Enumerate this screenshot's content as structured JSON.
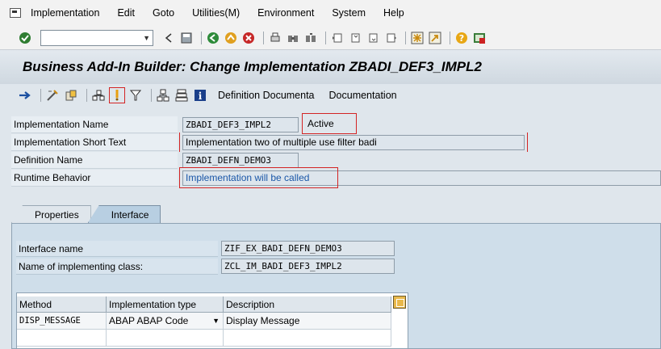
{
  "menu": {
    "items": [
      "Implementation",
      "Edit",
      "Goto",
      "Utilities(M)",
      "Environment",
      "System",
      "Help"
    ]
  },
  "title": "Business Add-In Builder: Change Implementation ZBADI_DEF3_IMPL2",
  "app_toolbar": {
    "definition_doc": "Definition Documenta",
    "documentation": "Documentation"
  },
  "form": {
    "impl_name_label": "Implementation Name",
    "impl_name_value": "ZBADI_DEF3_IMPL2",
    "status": "Active",
    "short_text_label": "Implementation Short Text",
    "short_text_value": "Implementation two of multiple use filter badi",
    "def_name_label": "Definition Name",
    "def_name_value": "ZBADI_DEFN_DEMO3",
    "runtime_label": "Runtime Behavior",
    "runtime_value": "Implementation will be called"
  },
  "tabs": [
    {
      "label": "Properties"
    },
    {
      "label": "Interface"
    }
  ],
  "interface": {
    "iface_name_label": "Interface name",
    "iface_name_value": "ZIF_EX_BADI_DEFN_DEMO3",
    "impl_class_label": "Name of implementing class:",
    "impl_class_value": "ZCL_IM_BADI_DEF3_IMPL2"
  },
  "methods_table": {
    "headers": [
      "Method",
      "Implementation type",
      "Description"
    ],
    "rows": [
      {
        "method": "DISP_MESSAGE",
        "impl_type": "ABAP ABAP Code",
        "description": "Display Message"
      }
    ]
  },
  "colors": {
    "highlight": "#d32424",
    "field_blue": "#1a57a8"
  }
}
